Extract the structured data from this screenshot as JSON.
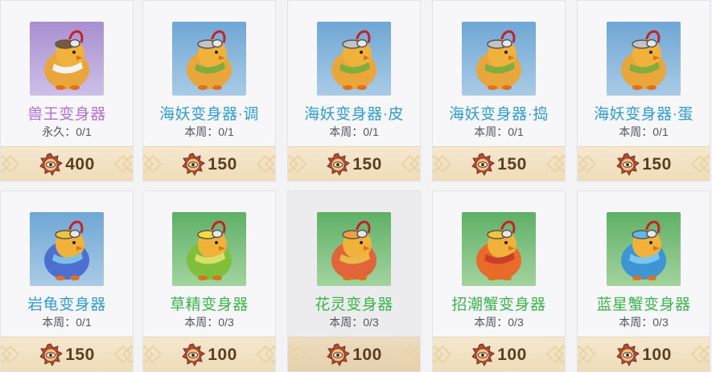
{
  "shop": {
    "items": [
      {
        "name": "兽王变身器",
        "name_color": "#b26fd6",
        "limit": "永久：0/1",
        "price": "400",
        "bg_top": "#a88fd0",
        "bg_bottom": "#cdbfe8",
        "theme": "beast",
        "icon": "beast-transformer-icon"
      },
      {
        "name": "海妖变身器·调",
        "name_color": "#2f9cd6",
        "limit": "本周：0/1",
        "price": "150",
        "bg_top": "#6fa7d4",
        "bg_bottom": "#a9cbe6",
        "theme": "sea",
        "icon": "siren-transformer-icon"
      },
      {
        "name": "海妖变身器·皮",
        "name_color": "#2f9cd6",
        "limit": "本周：0/1",
        "price": "150",
        "bg_top": "#6fa7d4",
        "bg_bottom": "#a9cbe6",
        "theme": "sea",
        "icon": "siren-transformer-icon"
      },
      {
        "name": "海妖变身器·捣",
        "name_color": "#2f9cd6",
        "limit": "本周：0/1",
        "price": "150",
        "bg_top": "#6fa7d4",
        "bg_bottom": "#a9cbe6",
        "theme": "sea",
        "icon": "siren-transformer-icon"
      },
      {
        "name": "海妖变身器·蛋",
        "name_color": "#2f9cd6",
        "limit": "本周：0/1",
        "price": "150",
        "bg_top": "#6fa7d4",
        "bg_bottom": "#a9cbe6",
        "theme": "sea",
        "icon": "siren-transformer-icon"
      },
      {
        "name": "岩龟变身器",
        "name_color": "#2f9cd6",
        "limit": "本周：0/1",
        "price": "150",
        "bg_top": "#6fa7d4",
        "bg_bottom": "#a9cbe6",
        "theme": "turtle",
        "icon": "rock-turtle-transformer-icon"
      },
      {
        "name": "草精变身器",
        "name_color": "#39b54a",
        "limit": "本周：0/3",
        "price": "100",
        "bg_top": "#5fb067",
        "bg_bottom": "#a3d39e",
        "theme": "grass",
        "icon": "grass-spirit-transformer-icon"
      },
      {
        "name": "花灵变身器",
        "name_color": "#39b54a",
        "limit": "本周：0/3",
        "price": "100",
        "bg_top": "#5fb067",
        "bg_bottom": "#a3d39e",
        "theme": "flower",
        "icon": "flower-spirit-transformer-icon"
      },
      {
        "name": "招潮蟹变身器",
        "name_color": "#39b54a",
        "limit": "本周：0/3",
        "price": "100",
        "bg_top": "#5fb067",
        "bg_bottom": "#a3d39e",
        "theme": "crab",
        "icon": "fiddler-crab-transformer-icon"
      },
      {
        "name": "蓝星蟹变身器",
        "name_color": "#39b54a",
        "limit": "本周：0/3",
        "price": "100",
        "bg_top": "#5fb067",
        "bg_bottom": "#a3d39e",
        "theme": "bluecrab",
        "icon": "blue-star-crab-transformer-icon"
      }
    ],
    "selected_index": 7,
    "currency_icon": "eye-medal-coin-icon"
  }
}
